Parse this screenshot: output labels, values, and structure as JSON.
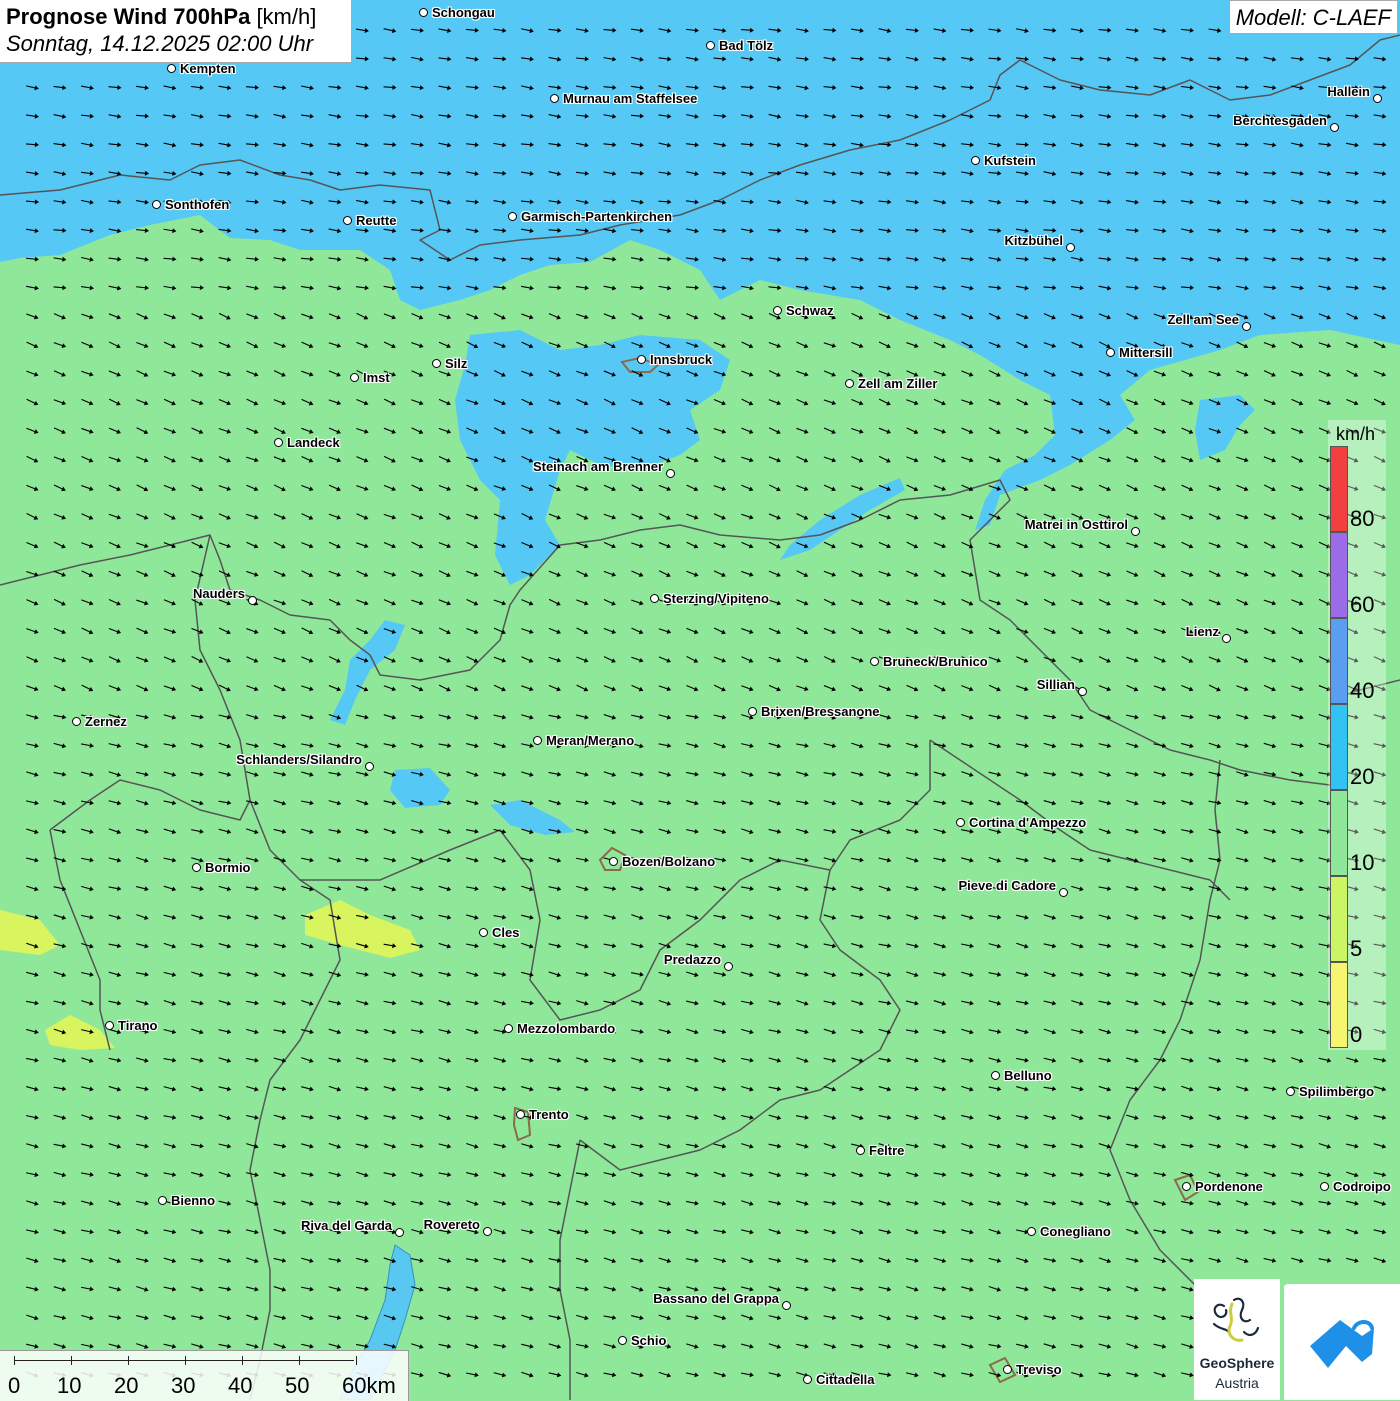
{
  "title": {
    "main_bold": "Prognose Wind 700hPa",
    "unit": "[km/h]",
    "datetime": "Sonntag, 14.12.2025 02:00 Uhr"
  },
  "model_label": "Modell: C-LAEF",
  "colors": {
    "land_wind_10_20": "#8fe89a",
    "wind_20_40": "#56c8f5",
    "wind_40_60": "#5b9df0",
    "wind_60_70": "#9b6be8",
    "wind_70_80": "#f24040",
    "wind_5_10": "#d8f560",
    "wind_0_5": "#f6f570",
    "border": "#555555",
    "arrow": "#000000"
  },
  "legend": {
    "unit": "km/h",
    "ticks": [
      "80",
      "60",
      "40",
      "20",
      "10",
      "5",
      "0"
    ],
    "segment_colors": [
      "#f24040",
      "#9b6be8",
      "#5b9df0",
      "#33c2f4",
      "#8fe89a",
      "#ccf565",
      "#f6f570"
    ]
  },
  "scale": {
    "labels": [
      "0",
      "10",
      "20",
      "30",
      "40",
      "50",
      "60km"
    ]
  },
  "logos": {
    "geosphere_line1": "GeoSphere",
    "geosphere_line2": "Austria"
  },
  "wind_field": {
    "direction_description": "predominantly west-northwest, arrows pointing east-southeast"
  },
  "cities": [
    {
      "name": "Schongau",
      "label_side": "right"
    },
    {
      "name": "Bad Tölz",
      "label_side": "right"
    },
    {
      "name": "Kempten",
      "label_side": "right"
    },
    {
      "name": "Murnau am Staffelsee",
      "label_side": "right"
    },
    {
      "name": "Hallein",
      "label_side": "left"
    },
    {
      "name": "Berchtesgaden",
      "label_side": "left"
    },
    {
      "name": "Kufstein",
      "label_side": "right"
    },
    {
      "name": "Sonthofen",
      "label_side": "right"
    },
    {
      "name": "Reutte",
      "label_side": "right"
    },
    {
      "name": "Garmisch-Partenkirchen",
      "label_side": "right"
    },
    {
      "name": "Kitzbühel",
      "label_side": "left"
    },
    {
      "name": "Schwaz",
      "label_side": "right"
    },
    {
      "name": "Zell am See",
      "label_side": "left"
    },
    {
      "name": "Innsbruck",
      "label_side": "right"
    },
    {
      "name": "Mittersill",
      "label_side": "right"
    },
    {
      "name": "Silz",
      "label_side": "right"
    },
    {
      "name": "Imst",
      "label_side": "right"
    },
    {
      "name": "Zell am Ziller",
      "label_side": "right"
    },
    {
      "name": "Landeck",
      "label_side": "right"
    },
    {
      "name": "Steinach am Brenner",
      "label_side": "left"
    },
    {
      "name": "Matrei in Osttirol",
      "label_side": "left"
    },
    {
      "name": "Nauders",
      "label_side": "left"
    },
    {
      "name": "Sterzing/Vipiteno",
      "label_side": "right"
    },
    {
      "name": "Lienz",
      "label_side": "left"
    },
    {
      "name": "Bruneck/Brunico",
      "label_side": "right"
    },
    {
      "name": "Sillian",
      "label_side": "left"
    },
    {
      "name": "Brixen/Bressanone",
      "label_side": "right"
    },
    {
      "name": "Zernez",
      "label_side": "right"
    },
    {
      "name": "Meran/Merano",
      "label_side": "right"
    },
    {
      "name": "Schlanders/Silandro",
      "label_side": "left"
    },
    {
      "name": "Cortina d'Ampezzo",
      "label_side": "right"
    },
    {
      "name": "Bozen/Bolzano",
      "label_side": "right"
    },
    {
      "name": "Bormio",
      "label_side": "right"
    },
    {
      "name": "Pieve di Cadore",
      "label_side": "left"
    },
    {
      "name": "Cles",
      "label_side": "right"
    },
    {
      "name": "Predazzo",
      "label_side": "left"
    },
    {
      "name": "Tirano",
      "label_side": "right"
    },
    {
      "name": "Mezzolombardo",
      "label_side": "right"
    },
    {
      "name": "Belluno",
      "label_side": "right"
    },
    {
      "name": "Spilimbergo",
      "label_side": "right"
    },
    {
      "name": "Trento",
      "label_side": "right"
    },
    {
      "name": "Feltre",
      "label_side": "right"
    },
    {
      "name": "Pordenone",
      "label_side": "right"
    },
    {
      "name": "Codroipo",
      "label_side": "right"
    },
    {
      "name": "Bienno",
      "label_side": "right"
    },
    {
      "name": "Riva del Garda",
      "label_side": "left"
    },
    {
      "name": "Rovereto",
      "label_side": "left"
    },
    {
      "name": "Conegliano",
      "label_side": "right"
    },
    {
      "name": "Bassano del Grappa",
      "label_side": "left"
    },
    {
      "name": "Schio",
      "label_side": "right"
    },
    {
      "name": "Treviso",
      "label_side": "right"
    },
    {
      "name": "Cittadella",
      "label_side": "right"
    }
  ]
}
